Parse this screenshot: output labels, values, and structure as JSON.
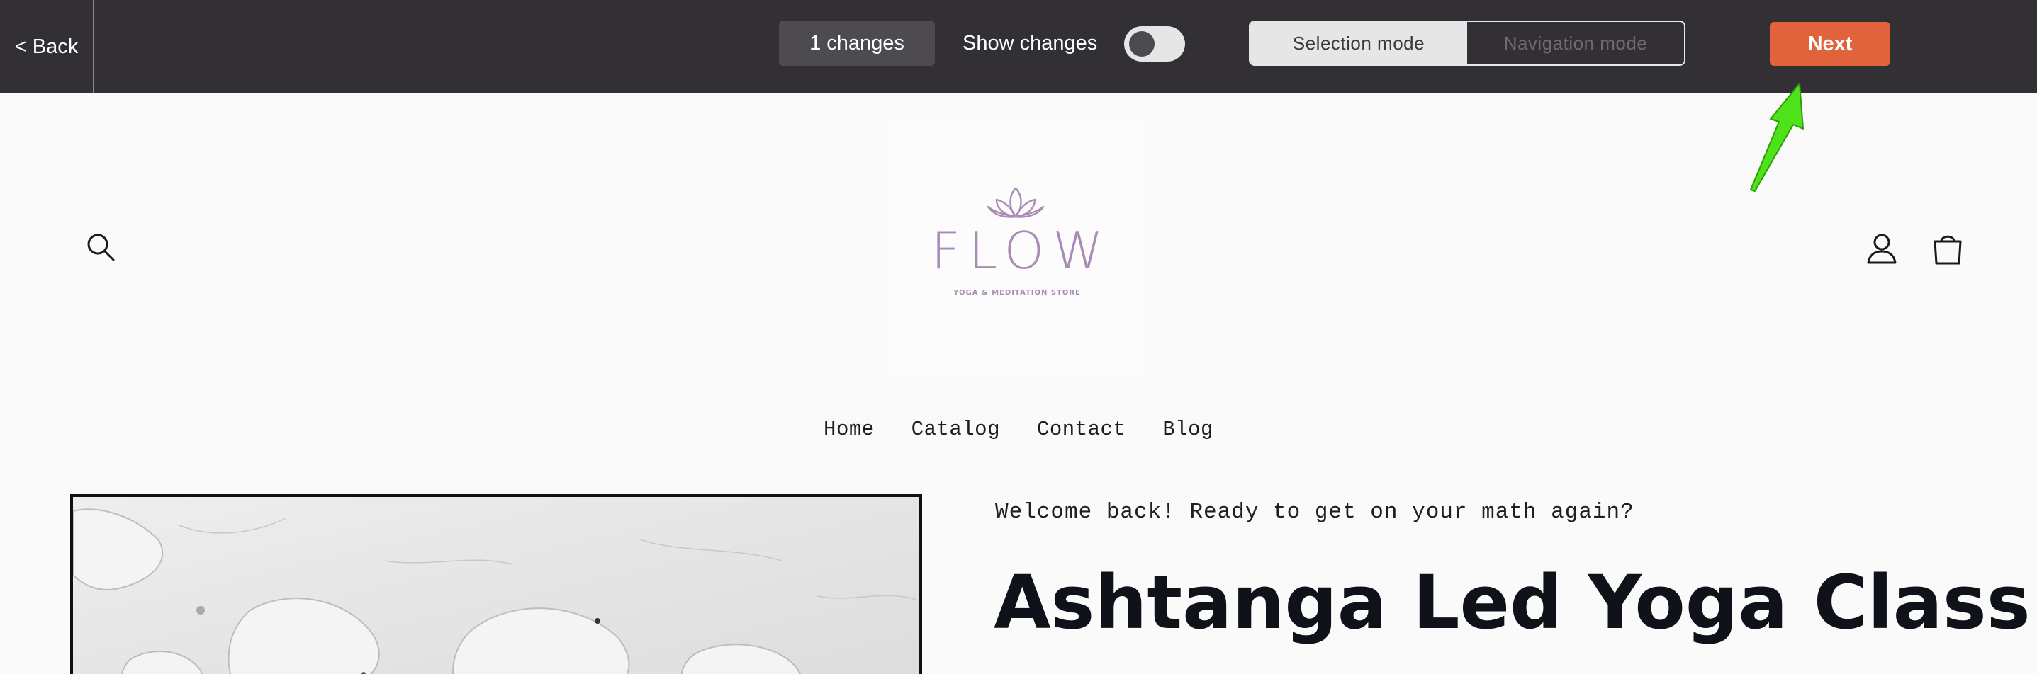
{
  "toolbar": {
    "back_label": "< Back",
    "changes_label": "1 changes",
    "show_changes_label": "Show changes",
    "show_changes_on": false,
    "modes": [
      {
        "label": "Selection mode",
        "active": true
      },
      {
        "label": "Navigation mode",
        "active": false
      }
    ],
    "next_label": "Next",
    "colors": {
      "bar": "#323035",
      "next": "#e0633b",
      "arrow": "#4ee21a"
    }
  },
  "store": {
    "logo": {
      "word": "FLOW",
      "tagline": "YOGA & MEDITATION STORE",
      "color": "#a98bb5"
    },
    "icons": [
      "search-icon",
      "account-icon",
      "cart-icon"
    ],
    "nav": [
      "Home",
      "Catalog",
      "Contact",
      "Blog"
    ]
  },
  "product": {
    "welcome": "Welcome back! Ready to get on your math again?",
    "title": "Ashtanga Led Yoga Class"
  }
}
